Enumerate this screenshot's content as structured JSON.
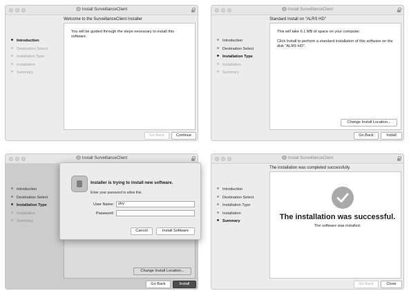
{
  "window_title": "Install SurveillanceClient",
  "steps": [
    "Introduction",
    "Destination Select",
    "Installation Type",
    "Installation",
    "Summary"
  ],
  "buttons": {
    "go_back": "Go Back",
    "continue": "Continue",
    "install": "Install",
    "change_location": "Change Install Location...",
    "close": "Close",
    "cancel": "Cancel",
    "install_software": "Install Software"
  },
  "intro": {
    "heading": "Welcome to the SurveillanceClient Installer",
    "body": "You will be guided through the steps necessary to install this software."
  },
  "install_type": {
    "heading": "Standard Install on \"ALRS HD\"",
    "space_text": "This will take 6.1 MB of space on your computer.",
    "instructions": "Click Install to perform a standard installation of this software on the disk \"ALRS HD\"."
  },
  "auth_dialog": {
    "title": "Installer is trying to install new software.",
    "subtitle": "Enter your password to allow this.",
    "username_label": "User Name:",
    "username_value": "ytry",
    "password_label": "Password:",
    "password_value": ""
  },
  "summary": {
    "heading": "The installation was completed successfully.",
    "success_title": "The installation was successful.",
    "success_sub": "The software was installed."
  },
  "colors": {
    "accent": "#4d4d4d",
    "panel": "#ececec"
  }
}
